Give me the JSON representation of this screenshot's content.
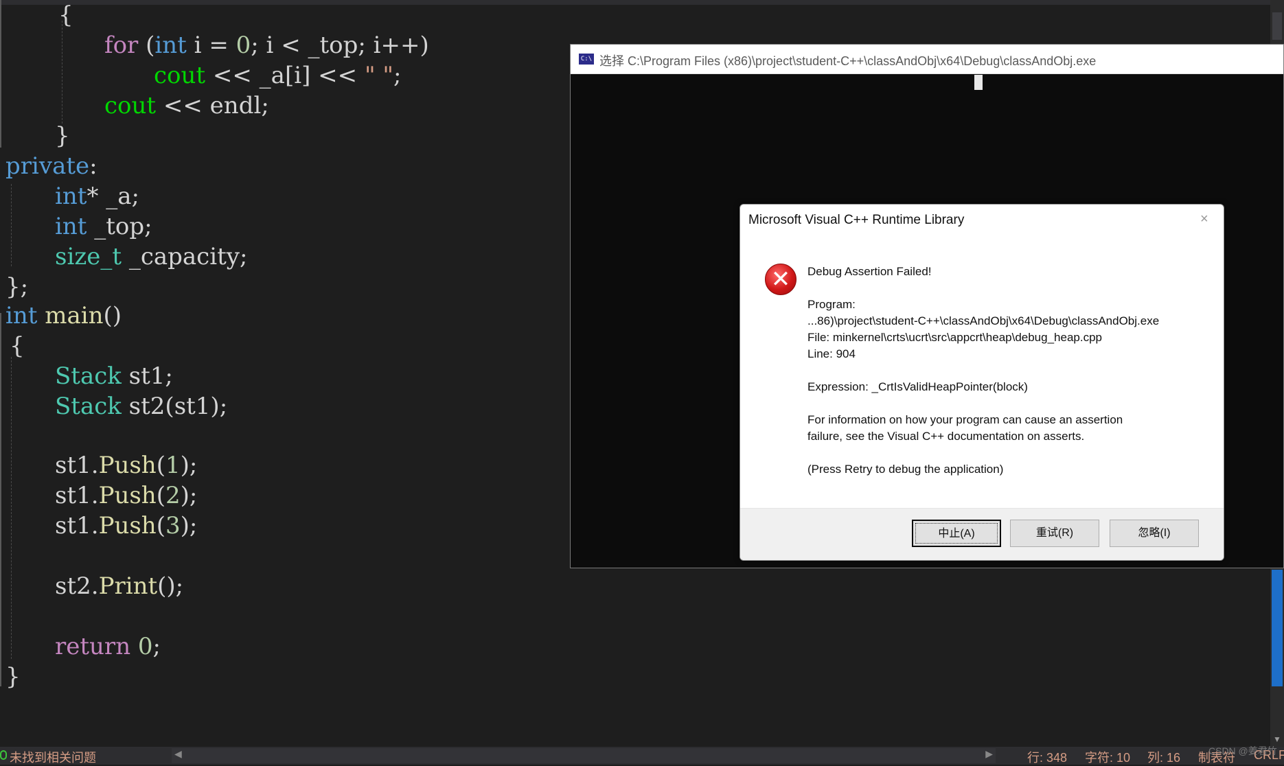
{
  "editor": {
    "lines": [
      [
        {
          "t": "{",
          "c": "p"
        }
      ],
      [
        {
          "t": "for",
          "c": "c"
        },
        {
          "t": " (",
          "c": "p"
        },
        {
          "t": "int",
          "c": "k"
        },
        {
          "t": " i = ",
          "c": "p"
        },
        {
          "t": "0",
          "c": "n"
        },
        {
          "t": "; i < _top; i++)",
          "c": "p"
        }
      ],
      [
        {
          "t": "cout",
          "c": "g"
        },
        {
          "t": " << _a[i] << ",
          "c": "p"
        },
        {
          "t": "\" \"",
          "c": "s"
        },
        {
          "t": ";",
          "c": "p"
        }
      ],
      [
        {
          "t": "cout",
          "c": "g"
        },
        {
          "t": " << endl;",
          "c": "p"
        }
      ],
      [
        {
          "t": "}",
          "c": "p"
        }
      ],
      [
        {
          "t": "private",
          "c": "k"
        },
        {
          "t": ":",
          "c": "p"
        }
      ],
      [
        {
          "t": "int",
          "c": "k"
        },
        {
          "t": "* _a;",
          "c": "p"
        }
      ],
      [
        {
          "t": "int",
          "c": "k"
        },
        {
          "t": " _top;",
          "c": "p"
        }
      ],
      [
        {
          "t": "size_t",
          "c": "t"
        },
        {
          "t": " _capacity;",
          "c": "p"
        }
      ],
      [
        {
          "t": "};",
          "c": "p"
        }
      ],
      [
        {
          "t": "int",
          "c": "k"
        },
        {
          "t": " ",
          "c": "p"
        },
        {
          "t": "main",
          "c": "f"
        },
        {
          "t": "()",
          "c": "p"
        }
      ],
      [
        {
          "t": "{",
          "c": "p"
        }
      ],
      [
        {
          "t": "Stack",
          "c": "t"
        },
        {
          "t": " st1;",
          "c": "p"
        }
      ],
      [
        {
          "t": "Stack",
          "c": "t"
        },
        {
          "t": " st2(st1);",
          "c": "p"
        }
      ],
      [
        {
          "t": "st1.",
          "c": "p"
        },
        {
          "t": "Push",
          "c": "f"
        },
        {
          "t": "(",
          "c": "p"
        },
        {
          "t": "1",
          "c": "n"
        },
        {
          "t": ");",
          "c": "p"
        }
      ],
      [
        {
          "t": "st1.",
          "c": "p"
        },
        {
          "t": "Push",
          "c": "f"
        },
        {
          "t": "(",
          "c": "p"
        },
        {
          "t": "2",
          "c": "n"
        },
        {
          "t": ");",
          "c": "p"
        }
      ],
      [
        {
          "t": "st1.",
          "c": "p"
        },
        {
          "t": "Push",
          "c": "f"
        },
        {
          "t": "(",
          "c": "p"
        },
        {
          "t": "3",
          "c": "n"
        },
        {
          "t": ");",
          "c": "p"
        }
      ],
      [
        {
          "t": "st2.",
          "c": "p"
        },
        {
          "t": "Print",
          "c": "f"
        },
        {
          "t": "();",
          "c": "p"
        }
      ],
      [
        {
          "t": "return",
          "c": "c"
        },
        {
          "t": " ",
          "c": "p"
        },
        {
          "t": "0",
          "c": "n"
        },
        {
          "t": ";",
          "c": "p"
        }
      ],
      [
        {
          "t": "}",
          "c": "p"
        }
      ]
    ]
  },
  "console": {
    "icon_text": "C:\\",
    "title": "选择 C:\\Program Files (x86)\\project\\student-C++\\classAndObj\\x64\\Debug\\classAndObj.exe"
  },
  "dialog": {
    "title": "Microsoft Visual C++ Runtime Library",
    "close": "×",
    "icon": "error-icon",
    "heading": "Debug Assertion Failed!",
    "program_label": "Program:",
    "program_path": "...86)\\project\\student-C++\\classAndObj\\x64\\Debug\\classAndObj.exe",
    "file": "File: minkernel\\crts\\ucrt\\src\\appcrt\\heap\\debug_heap.cpp",
    "line": "Line: 904",
    "expression": "Expression: _CrtIsValidHeapPointer(block)",
    "info_1": "For information on how your program can cause an assertion",
    "info_2": "failure, see the Visual C++ documentation on asserts.",
    "press_retry": "(Press Retry to debug the application)",
    "buttons": {
      "abort": "中止(A)",
      "retry": "重试(R)",
      "ignore": "忽略(I)"
    }
  },
  "statusbar": {
    "issues": "未找到相关问题",
    "line": "行: 348",
    "char": "字符: 10",
    "col": "列: 16",
    "tabs": "制表符",
    "eol": "CRLF",
    "watermark": "CSDN @姜君竹"
  },
  "colors": {
    "editor_bg": "#1e1e1e",
    "keyword": "#569cd6",
    "control": "#c586c0",
    "type": "#4ec9b0",
    "function": "#dcdcaa",
    "number": "#b5cea8",
    "stream": "#00d700"
  }
}
